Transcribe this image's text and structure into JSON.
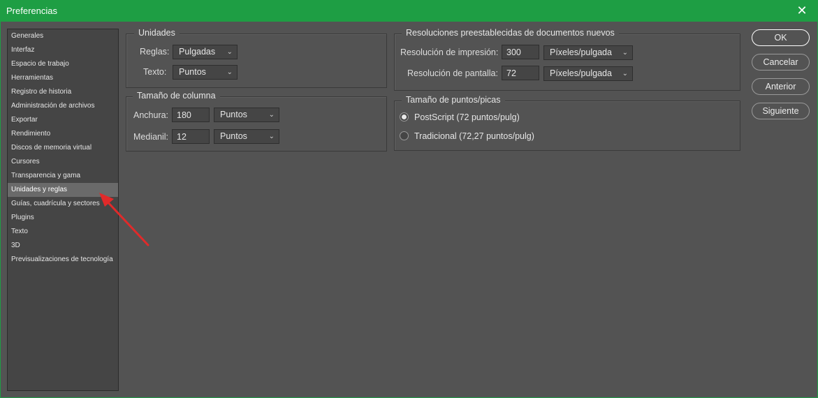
{
  "window": {
    "title": "Preferencias",
    "close_glyph": "✕",
    "accent_color": "#1e9e44"
  },
  "sidebar": {
    "items": [
      {
        "label": "Generales"
      },
      {
        "label": "Interfaz"
      },
      {
        "label": "Espacio de trabajo"
      },
      {
        "label": "Herramientas"
      },
      {
        "label": "Registro de historia"
      },
      {
        "label": "Administración de archivos"
      },
      {
        "label": "Exportar"
      },
      {
        "label": "Rendimiento"
      },
      {
        "label": "Discos de memoria virtual"
      },
      {
        "label": "Cursores"
      },
      {
        "label": "Transparencia y gama"
      },
      {
        "label": "Unidades y reglas",
        "selected": true
      },
      {
        "label": "Guías, cuadrícula y sectores"
      },
      {
        "label": "Plugins"
      },
      {
        "label": "Texto"
      },
      {
        "label": "3D"
      },
      {
        "label": "Previsualizaciones de tecnología"
      }
    ]
  },
  "units": {
    "legend": "Unidades",
    "rulers_label": "Reglas:",
    "rulers_value": "Pulgadas",
    "type_label": "Texto:",
    "type_value": "Puntos"
  },
  "column_size": {
    "legend": "Tamaño de columna",
    "width_label": "Anchura:",
    "width_value": "180",
    "width_unit": "Puntos",
    "gutter_label": "Medianil:",
    "gutter_value": "12",
    "gutter_unit": "Puntos"
  },
  "resolutions": {
    "legend": "Resoluciones preestablecidas de documentos nuevos",
    "print_label": "Resolución de impresión:",
    "print_value": "300",
    "print_unit": "Píxeles/pulgada",
    "screen_label": "Resolución de pantalla:",
    "screen_value": "72",
    "screen_unit": "Píxeles/pulgada"
  },
  "point_size": {
    "legend": "Tamaño de puntos/picas",
    "options": [
      {
        "label": "PostScript (72 puntos/pulg)",
        "checked": true
      },
      {
        "label": "Tradicional (72,27 puntos/pulg)",
        "checked": false
      }
    ]
  },
  "buttons": {
    "ok": "OK",
    "cancel": "Cancelar",
    "previous": "Anterior",
    "next": "Siguiente"
  },
  "icons": {
    "dropdown": "chevron-down-icon",
    "annotation": "red-arrow-annotation"
  },
  "colors": {
    "annotation_arrow": "#e02a2a",
    "selected_item": "#6a6a6a"
  }
}
